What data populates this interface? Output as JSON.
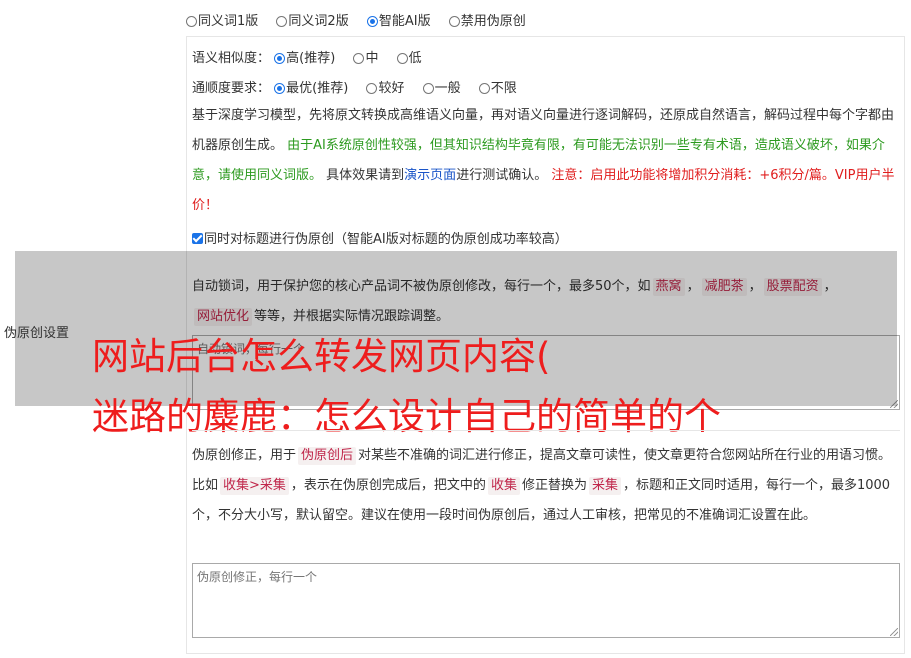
{
  "mode_options": [
    {
      "label": "同义词1版",
      "selected": false
    },
    {
      "label": "同义词2版",
      "selected": false
    },
    {
      "label": "智能AI版",
      "selected": true
    },
    {
      "label": "禁用伪原创",
      "selected": false
    }
  ],
  "similarity": {
    "label": "语义相似度：",
    "options": [
      {
        "label": "高(推荐)",
        "selected": true
      },
      {
        "label": "中",
        "selected": false
      },
      {
        "label": "低",
        "selected": false
      }
    ]
  },
  "fluency": {
    "label": "通顺度要求：",
    "options": [
      {
        "label": "最优(推荐)",
        "selected": true
      },
      {
        "label": "较好",
        "selected": false
      },
      {
        "label": "一般",
        "selected": false
      },
      {
        "label": "不限",
        "selected": false
      }
    ]
  },
  "description": {
    "part1": "基于深度学习模型，先将原文转换成高维语义向量，再对语义向量进行逐词解码，还原成自然语言，解码过程中每个字都由机器原创生成。",
    "green": "由于AI系统原创性较强，但其知识结构毕竟有限，有可能无法识别一些专有术语，造成语义破坏，如果介意，请使用同义词版。",
    "part2": "具体效果请到",
    "link": "演示页面",
    "part3": "进行测试确认。",
    "red": "注意：启用此功能将增加积分消耗：+6积分/篇。VIP用户半价！"
  },
  "title_checkbox": {
    "checked": true,
    "label": "同时对标题进行伪原创（智能AI版对标题的伪原创成功率较高）"
  },
  "section_label": "伪原创设置",
  "lock_words": {
    "intro": "自动锁词，用于保护您的核心产品词不被伪原创修改，每行一个，最多50个，如",
    "examples": [
      "燕窝",
      "减肥茶",
      "股票配资",
      "网站优化"
    ],
    "sep": "，",
    "outro": "等等，并根据实际情况跟踪调整。",
    "placeholder": "自动锁词，每行一个"
  },
  "headline": {
    "line1": "网站后台怎么转发网页内容(",
    "line2": "迷路的麋鹿：怎么设计自己的简单的个"
  },
  "correction": {
    "p1": "伪原创修正，用于",
    "kw1": "伪原创后",
    "p2": "对某些不准确的词汇进行修正，提高文章可读性，使文章更符合您网站所在行业的用语习惯。比如",
    "kw2": "收集>采集",
    "p3": "，表示在伪原创完成后，把文中的",
    "kw3": "收集",
    "p4": "修正替换为",
    "kw4": "采集",
    "p5": "，标题和正文同时适用，每行一个，最多1000个，不分大小写，默认留空。建议在使用一段时间伪原创后，通过人工审核，把常见的不准确词汇设置在此。",
    "placeholder": "伪原创修正，每行一个"
  }
}
